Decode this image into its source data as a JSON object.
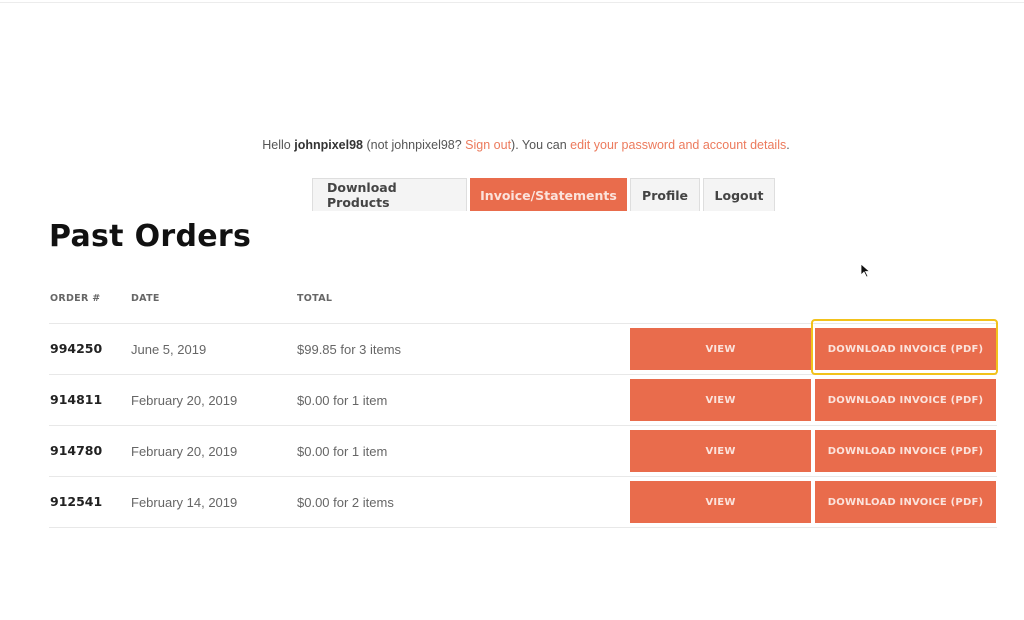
{
  "greeting": {
    "hello": "Hello ",
    "username": "johnpixel98",
    "not_prefix": " (not johnpixel98? ",
    "sign_out_link": "Sign out",
    "middle": "). You can ",
    "account_link": "edit your password and account details",
    "end": "."
  },
  "tabs": [
    {
      "label": "Download Products",
      "active": false
    },
    {
      "label": "Invoice/Statements",
      "active": true
    },
    {
      "label": "Profile",
      "active": false
    },
    {
      "label": "Logout",
      "active": false
    }
  ],
  "page_title": "Past Orders",
  "table": {
    "headers": {
      "order": "ORDER #",
      "date": "DATE",
      "total": "TOTAL"
    },
    "rows": [
      {
        "order": "994250",
        "date": "June 5, 2019",
        "total": "$99.85 for 3 items",
        "view_label": "VIEW",
        "download_label": "DOWNLOAD INVOICE (PDF)",
        "highlighted": true
      },
      {
        "order": "914811",
        "date": "February 20, 2019",
        "total": "$0.00 for 1 item",
        "view_label": "VIEW",
        "download_label": "DOWNLOAD INVOICE (PDF)"
      },
      {
        "order": "914780",
        "date": "February 20, 2019",
        "total": "$0.00 for 1 item",
        "view_label": "VIEW",
        "download_label": "DOWNLOAD INVOICE (PDF)"
      },
      {
        "order": "912541",
        "date": "February 14, 2019",
        "total": "$0.00 for 2 items",
        "view_label": "VIEW",
        "download_label": "DOWNLOAD INVOICE (PDF)"
      }
    ]
  },
  "colors": {
    "accent": "#e96c4c",
    "link": "#ec7a5c",
    "highlight": "#f2c21b"
  }
}
